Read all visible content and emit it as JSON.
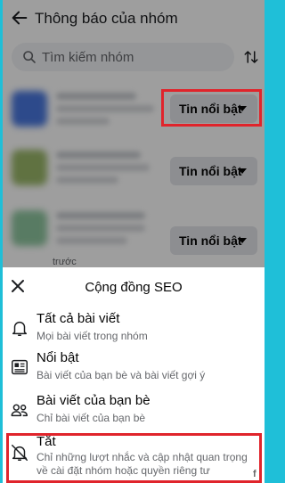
{
  "header": {
    "title": "Thông báo của nhóm"
  },
  "search": {
    "placeholder": "Tìm kiếm nhóm"
  },
  "groups": [
    {
      "setting": "Tin nổi bật"
    },
    {
      "setting": "Tin nổi bật"
    },
    {
      "setting": "Tin nổi bật"
    }
  ],
  "partial_text": "trước",
  "sheet": {
    "title": "Cộng đồng SEO",
    "options": [
      {
        "title": "Tất cả bài viết",
        "desc": "Mọi bài viết trong nhóm",
        "icon": "bell-icon"
      },
      {
        "title": "Nổi bật",
        "desc": "Bài viết của bạn bè và bài viết gợi ý",
        "icon": "newsfeed-icon"
      },
      {
        "title": "Bài viết của bạn bè",
        "desc": "Chỉ bài viết của bạn bè",
        "icon": "friends-icon"
      },
      {
        "title": "Tắt",
        "desc": "Chỉ những lượt nhắc và cập nhật quan trọng về cài đặt nhóm hoặc quyền riêng tư",
        "icon": "bell-off-icon"
      }
    ]
  },
  "colors": {
    "highlight": "#e0242b",
    "frame": "#1fbfd8"
  }
}
